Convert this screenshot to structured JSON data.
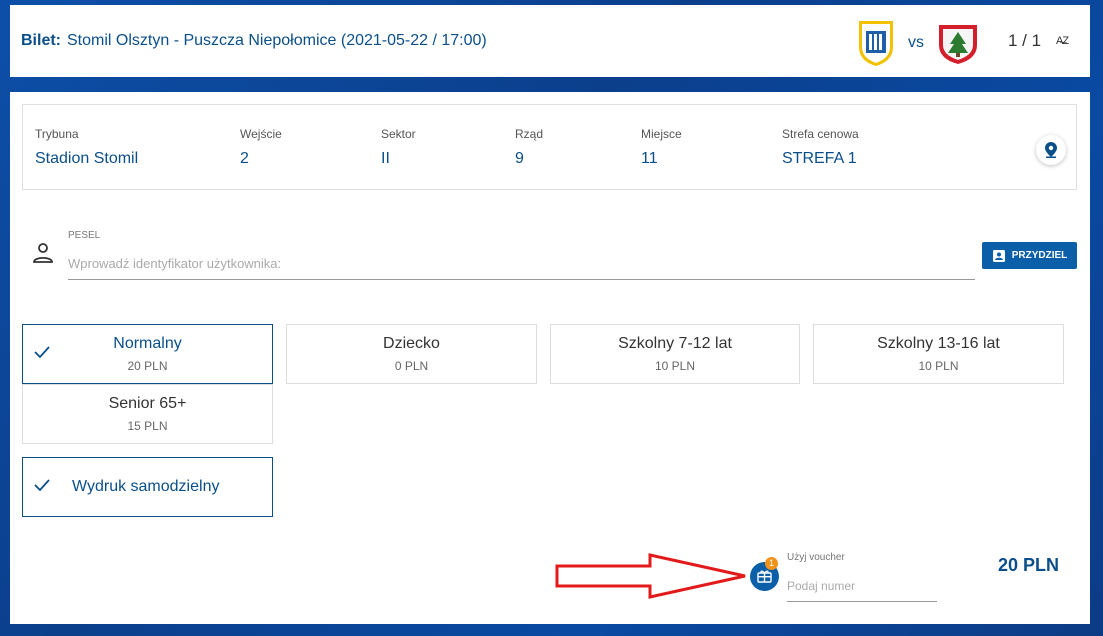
{
  "header": {
    "label": "Bilet:",
    "match": "Stomil Olsztyn - Puszcza Niepołomice (2021-05-22 / 17:00)",
    "vs": "vs",
    "counter": "1 / 1",
    "sort_icon": "sort-az-icon"
  },
  "details": [
    {
      "key": "Trybuna",
      "value": "Stadion Stomil"
    },
    {
      "key": "Wejście",
      "value": "2"
    },
    {
      "key": "Sektor",
      "value": "II"
    },
    {
      "key": "Rząd",
      "value": "9"
    },
    {
      "key": "Miejsce",
      "value": "11"
    },
    {
      "key": "Strefa cenowa",
      "value": "STREFA 1"
    }
  ],
  "pesel": {
    "label": "PESEL",
    "placeholder": "Wprowadź identyfikator użytkownika:"
  },
  "assign_button": "PRZYDZIEL",
  "ticket_types": [
    {
      "name": "Normalny",
      "price": "20 PLN",
      "selected": true
    },
    {
      "name": "Dziecko",
      "price": "0 PLN",
      "selected": false
    },
    {
      "name": "Szkolny 7-12 lat",
      "price": "10 PLN",
      "selected": false
    },
    {
      "name": "Szkolny 13-16 lat",
      "price": "10 PLN",
      "selected": false
    },
    {
      "name": "Senior 65+",
      "price": "15 PLN",
      "selected": false
    }
  ],
  "print_option": {
    "name": "Wydruk samodzielny",
    "selected": true
  },
  "voucher": {
    "badge": "1",
    "label": "Użyj voucher",
    "placeholder": "Podaj numer"
  },
  "total": "20 PLN",
  "colors": {
    "accent": "#0b4f8a",
    "button": "#0b5fa8",
    "badge": "#f0931a",
    "arrow": "#e21a1a"
  }
}
